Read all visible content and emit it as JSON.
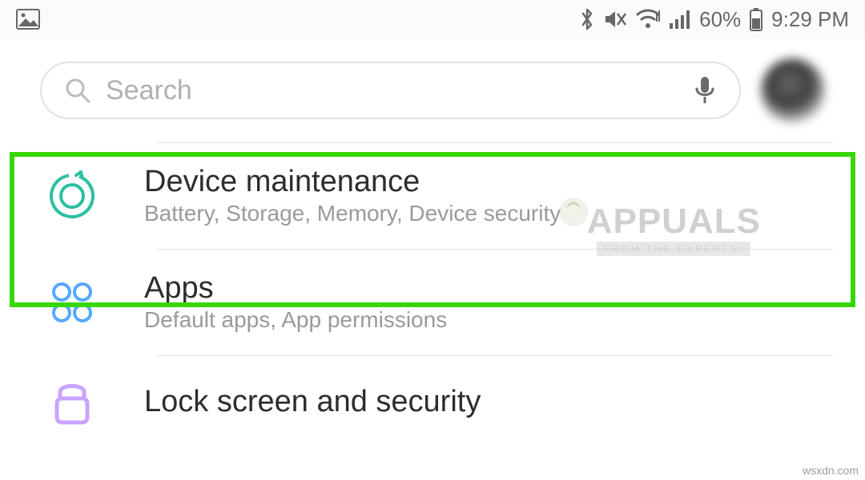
{
  "status_bar": {
    "battery_percent": "60%",
    "time": "9:29 PM"
  },
  "search": {
    "placeholder": "Search"
  },
  "settings_items": [
    {
      "title": "Device maintenance",
      "subtitle": "Battery, Storage, Memory, Device security"
    },
    {
      "title": "Apps",
      "subtitle": "Default apps, App permissions"
    },
    {
      "title": "Lock screen and security",
      "subtitle": ""
    }
  ],
  "watermark": {
    "main": "APPUALS",
    "sub": "FROM THE EXPERTS!"
  },
  "credit": "wsxdn.com",
  "colors": {
    "highlight": "#38d600",
    "maintenance_icon": "#2bbfa3",
    "apps_icon": "#55aaff",
    "lock_icon": "#c9a4ff"
  }
}
